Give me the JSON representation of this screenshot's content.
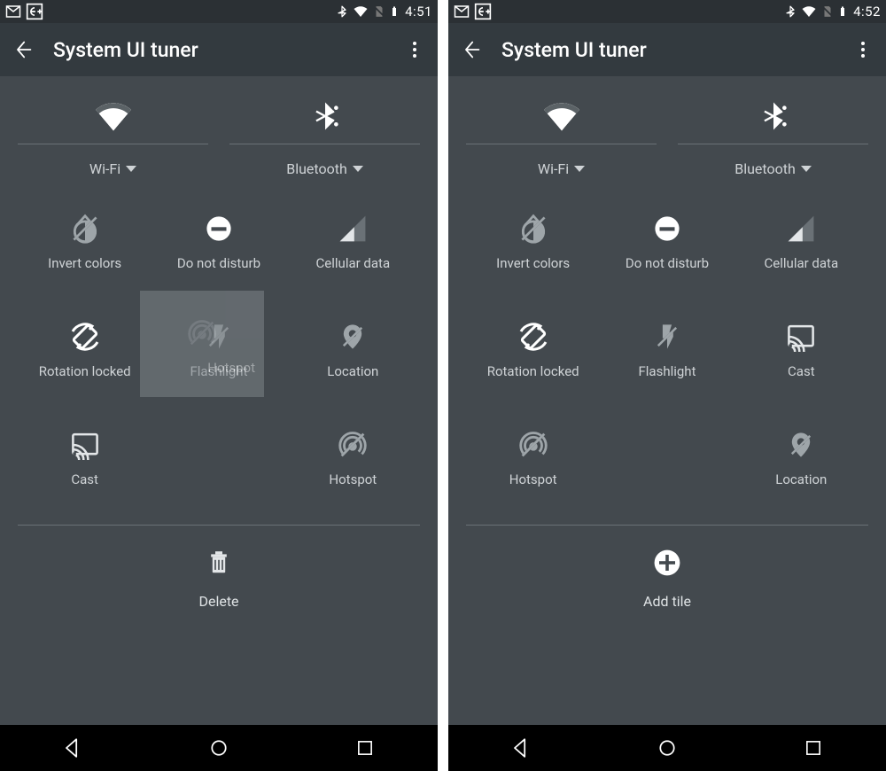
{
  "left": {
    "status": {
      "time": "4:51"
    },
    "appbar": {
      "title": "System UI tuner"
    },
    "top": [
      {
        "icon": "wifi-icon",
        "label": "Wi-Fi"
      },
      {
        "icon": "bluetooth-icon",
        "label": "Bluetooth"
      }
    ],
    "tiles": [
      {
        "icon": "invert-colors-icon",
        "label": "Invert colors"
      },
      {
        "icon": "dnd-icon",
        "label": "Do not disturb"
      },
      {
        "icon": "cellular-icon",
        "label": "Cellular data"
      },
      {
        "icon": "rotation-icon",
        "label": "Rotation locked"
      },
      {
        "icon": "flashlight-icon",
        "label": "Flashlight"
      },
      {
        "icon": "location-icon",
        "label": "Location"
      },
      {
        "icon": "cast-icon",
        "label": "Cast"
      },
      {
        "icon": "",
        "label": ""
      },
      {
        "icon": "hotspot-icon",
        "label": "Hotspot"
      }
    ],
    "ghost": {
      "icon": "hotspot-icon",
      "label": "Hotspot"
    },
    "action": {
      "icon": "delete-icon",
      "label": "Delete"
    }
  },
  "right": {
    "status": {
      "time": "4:52"
    },
    "appbar": {
      "title": "System UI tuner"
    },
    "top": [
      {
        "icon": "wifi-icon",
        "label": "Wi-Fi"
      },
      {
        "icon": "bluetooth-icon",
        "label": "Bluetooth"
      }
    ],
    "tiles": [
      {
        "icon": "invert-colors-icon",
        "label": "Invert colors"
      },
      {
        "icon": "dnd-icon",
        "label": "Do not disturb"
      },
      {
        "icon": "cellular-icon",
        "label": "Cellular data"
      },
      {
        "icon": "rotation-icon",
        "label": "Rotation locked"
      },
      {
        "icon": "flashlight-icon",
        "label": "Flashlight"
      },
      {
        "icon": "cast-icon",
        "label": "Cast"
      },
      {
        "icon": "hotspot-icon",
        "label": "Hotspot"
      },
      {
        "icon": "",
        "label": ""
      },
      {
        "icon": "location-icon",
        "label": "Location"
      }
    ],
    "action": {
      "icon": "add-icon",
      "label": "Add tile"
    }
  }
}
